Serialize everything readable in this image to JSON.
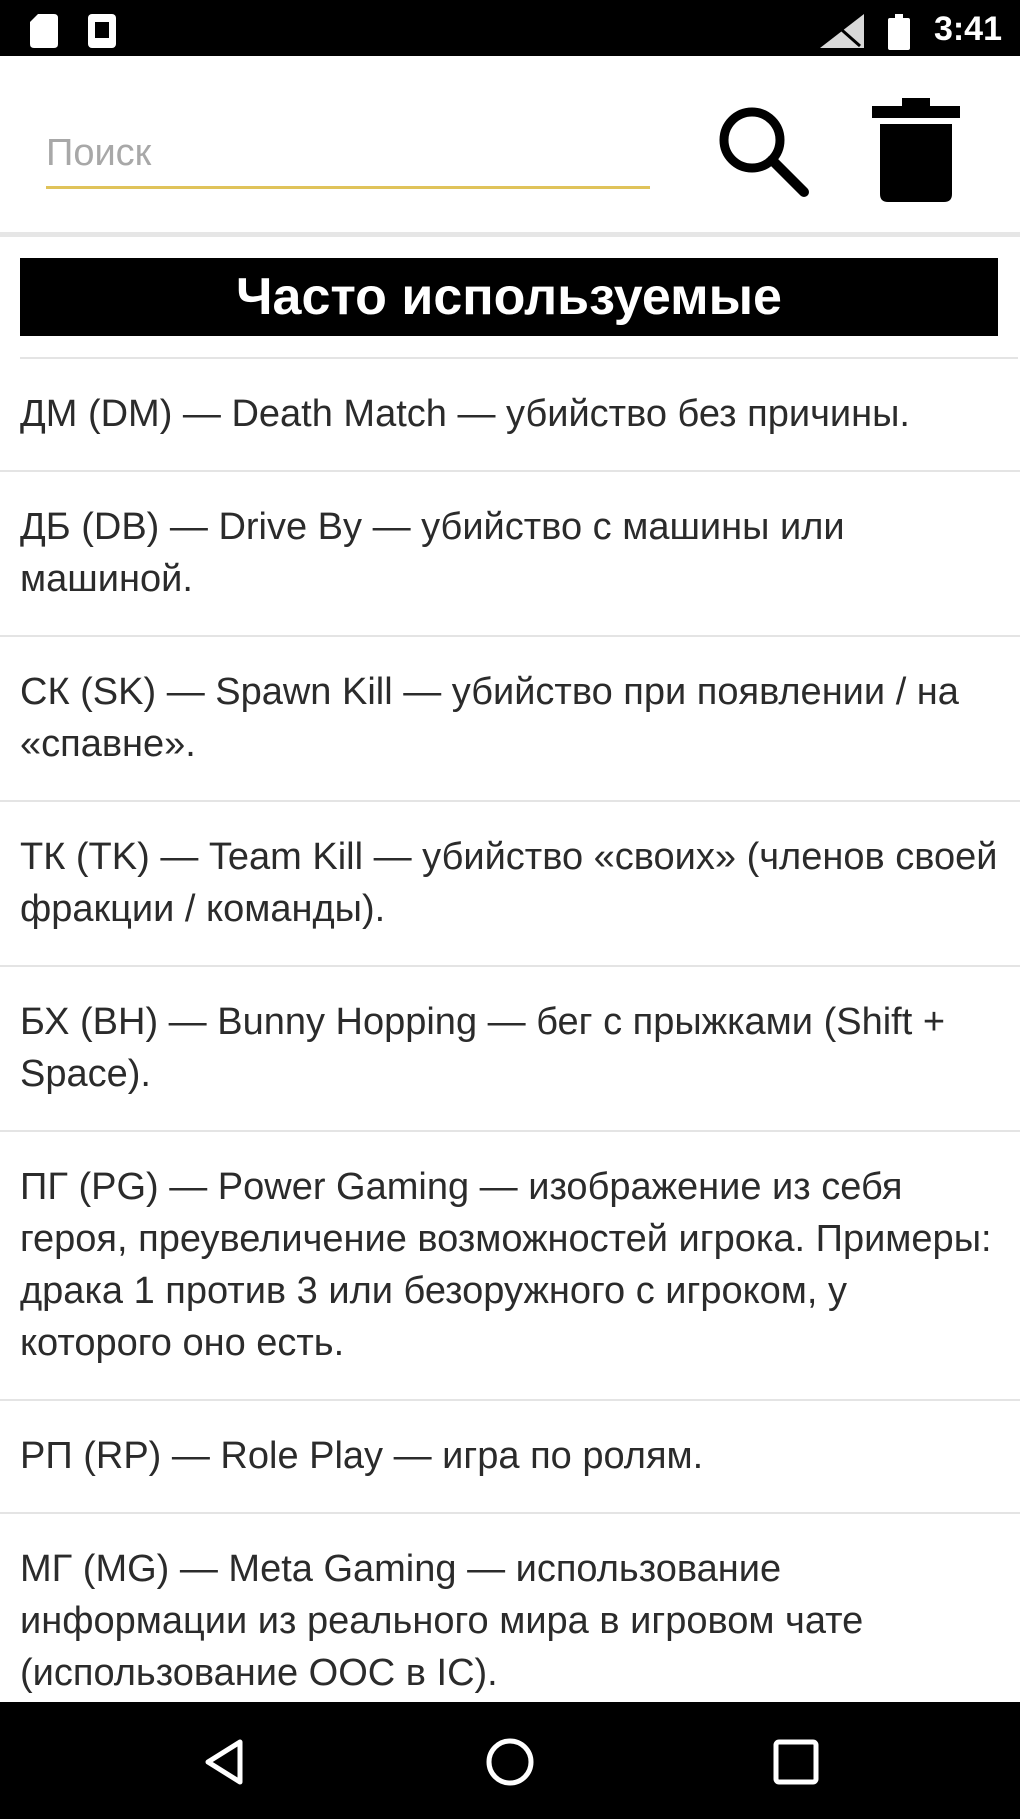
{
  "status_bar": {
    "time": "3:41",
    "icons": [
      "sd-card-icon",
      "notification-icon",
      "signal-icon",
      "battery-icon"
    ]
  },
  "toolbar": {
    "search_placeholder": "Поиск",
    "search_icon": "search-icon",
    "delete_icon": "trash-icon",
    "accent_color": "#e0c35a"
  },
  "section": {
    "title": "Часто используемые"
  },
  "items": [
    {
      "text": "ДМ (DM) — Death Match — убийство без причины."
    },
    {
      "text": "ДБ (DB) — Drive By — убийство с машины или машиной."
    },
    {
      "text": "СК (SK) — Spawn Kill — убийство при появлении / на «спавне»."
    },
    {
      "text": "ТК (TK) — Team Kill — убийство «своих» (членов своей фракции / команды)."
    },
    {
      "text": "БХ (BH) — Bunny Hopping — бег с прыжками (Shift + Space)."
    },
    {
      "text": "ПГ (PG) — Power Gaming — изображение из себя героя, преувеличение возможностей игрока. Примеры: драка 1 против 3 или безоружного с игроком, у которого оно есть."
    },
    {
      "text": "РП (RP) — Role Play — игра по ролям."
    },
    {
      "text": "МГ (MG) — Meta Gaming — использование информации из реального мира в игровом чате (использование OOC в IC)."
    }
  ],
  "nav_bar": {
    "icons": [
      "back-icon",
      "home-icon",
      "recents-icon"
    ]
  }
}
